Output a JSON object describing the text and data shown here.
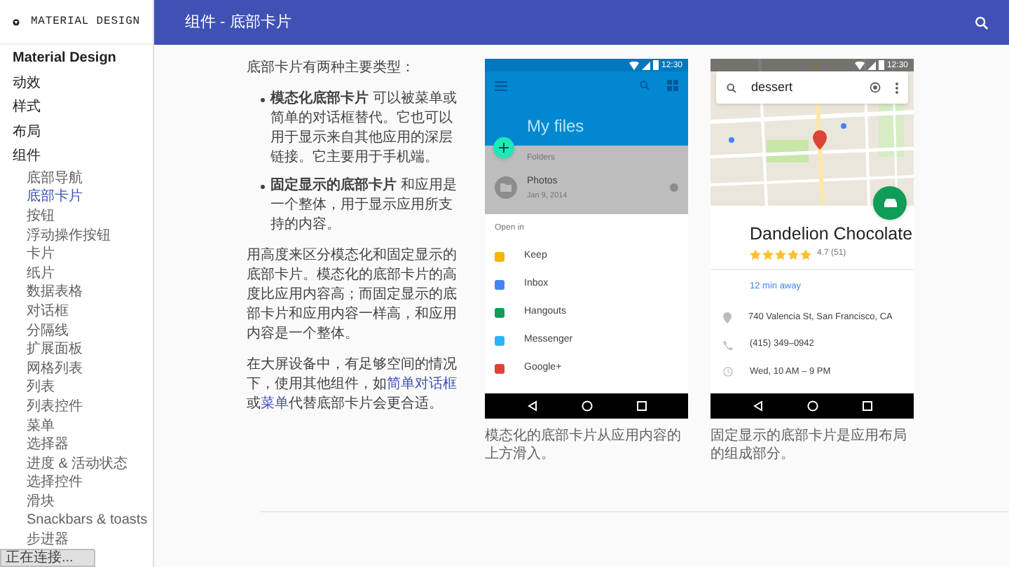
{
  "app_bar": {
    "logo_text": "MATERIAL DESIGN",
    "title": "组件 - 底部卡片"
  },
  "sidebar": {
    "items": [
      {
        "label": "Material Design",
        "bold": true
      },
      {
        "label": "动效"
      },
      {
        "label": "样式"
      },
      {
        "label": "布局"
      },
      {
        "label": "组件",
        "children": [
          {
            "label": "底部导航",
            "selected": false
          },
          {
            "label": "底部卡片",
            "selected": true
          },
          {
            "label": "按钮",
            "selected": false
          },
          {
            "label": "浮动操作按钮",
            "selected": false
          },
          {
            "label": "卡片",
            "selected": false
          },
          {
            "label": "纸片",
            "selected": false
          },
          {
            "label": "数据表格",
            "selected": false
          },
          {
            "label": "对话框",
            "selected": false
          },
          {
            "label": "分隔线",
            "selected": false
          },
          {
            "label": "扩展面板",
            "selected": false
          },
          {
            "label": "网格列表",
            "selected": false
          },
          {
            "label": "列表",
            "selected": false
          },
          {
            "label": "列表控件",
            "selected": false
          },
          {
            "label": "菜单",
            "selected": false
          },
          {
            "label": "选择器",
            "selected": false
          },
          {
            "label": "进度 & 活动状态",
            "selected": false
          },
          {
            "label": "选择控件",
            "selected": false
          },
          {
            "label": "滑块",
            "selected": false
          },
          {
            "label": "Snackbars & toasts",
            "selected": false
          },
          {
            "label": "步进器",
            "selected": false
          }
        ]
      }
    ]
  },
  "content": {
    "intro": "底部卡片有两种主要类型：",
    "bullets": [
      "**模态化底部卡片** 可以被菜单或简单的对话框替代。它也可以用于显示来自其他应用的深层链接。它主要用于手机端。",
      "**固定显示的底部卡片** 和应用是一个整体，用于显示应用所支持的内容。"
    ],
    "paragraph": "用高度来区分模态化和固定显示的底部卡片。模态化的底部卡片的高度比应用内容高；而固定显示的底部卡片和应用内容一样高，和应用内容是一个整体。",
    "note": [
      {
        "kind": "text",
        "text": "在大屏设备中，有足够空间的情况下，使用其他组件，如"
      },
      {
        "kind": "link",
        "text": "简单对话框"
      },
      {
        "kind": "text",
        "text": "或"
      },
      {
        "kind": "link",
        "text": "菜单"
      },
      {
        "kind": "text",
        "text": "代替底部卡片会更合适。"
      }
    ]
  },
  "modal_phone": {
    "time": "12:30",
    "title": "My files",
    "section": "Folders",
    "file": {
      "name": "Photos",
      "date": "Jan 9, 2014"
    },
    "sheet_title": "Open in",
    "apps": [
      {
        "label": "Keep",
        "color": "#f6b400"
      },
      {
        "label": "Inbox",
        "color": "#4285f4"
      },
      {
        "label": "Hangouts",
        "color": "#0f9d58"
      },
      {
        "label": "Messenger",
        "color": "#29b6f6"
      },
      {
        "label": "Google+",
        "color": "#db4437"
      }
    ],
    "caption": "模态化的底部卡片从应用内容的上方滑入。"
  },
  "persistent_phone": {
    "time": "12:30",
    "search": "dessert",
    "place": "Dandelion Chocolate",
    "stars": 5,
    "rating": "4.7 (51)",
    "travel": "12 min away",
    "details": [
      {
        "kind": "place",
        "text": "740 Valencia St, San Francisco, CA"
      },
      {
        "kind": "phone",
        "text": "(415) 349–0942"
      },
      {
        "kind": "clock",
        "text": "Wed, 10 AM – 9 PM"
      }
    ],
    "caption": "固定显示的底部卡片是应用布局的组成部分。"
  },
  "browser_status": "正在连接..."
}
